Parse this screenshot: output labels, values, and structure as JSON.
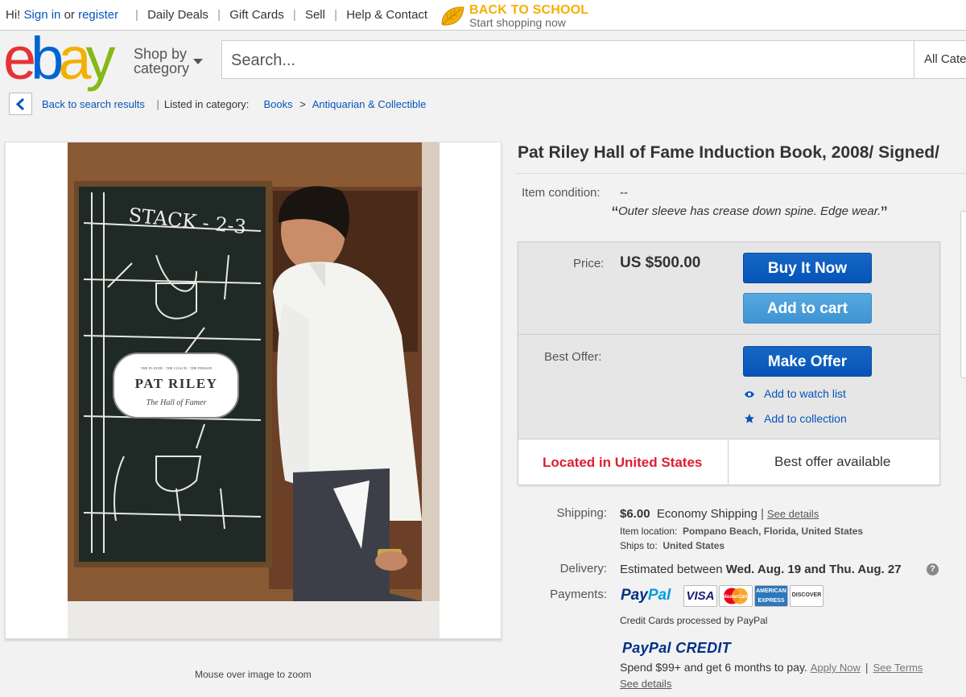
{
  "topbar": {
    "greeting": "Hi!",
    "sign_in": "Sign in",
    "or": "or",
    "register": "register",
    "nav": [
      "Daily Deals",
      "Gift Cards",
      "Sell",
      "Help & Contact"
    ],
    "promo_title": "BACK TO SCHOOL",
    "promo_sub": "Start shopping now"
  },
  "header": {
    "logo_letters": [
      "e",
      "b",
      "a",
      "y"
    ],
    "logo_colors": [
      "#e53238",
      "#0064d2",
      "#f5af02",
      "#86b817"
    ],
    "shop_by_line1": "Shop by",
    "shop_by_line2": "category",
    "search_placeholder": "Search...",
    "category_select": "All Cate"
  },
  "breadcrumb": {
    "back": "Back to search results",
    "listed": "Listed in category:",
    "cat1": "Books",
    "arrow": ">",
    "cat2": "Antiquarian & Collectible"
  },
  "image": {
    "cover_title": "PAT RILEY",
    "cover_tag": "THE PLAYER · THE COACH · THE PERSON",
    "cover_sub": "The Hall of Famer",
    "chalk_text": "STACK - 2-3",
    "zoom_hint": "Mouse over image to zoom"
  },
  "item": {
    "title": "Pat Riley Hall of Fame Induction Book, 2008/ Signed/",
    "condition_label": "Item condition:",
    "condition_value": "--",
    "condition_note": "Outer sleeve has crease down spine. Edge wear.",
    "open_quote": "“",
    "close_quote": "”"
  },
  "buybox": {
    "price_label": "Price:",
    "price": "US $500.00",
    "buy_now": "Buy It Now",
    "add_to_cart": "Add to cart",
    "best_offer_label": "Best Offer:",
    "make_offer": "Make Offer",
    "watch": "Add to watch list",
    "collection": "Add to collection",
    "located": "Located in United States",
    "best_offer_available": "Best offer available"
  },
  "shipping": {
    "label": "Shipping:",
    "cost": "$6.00",
    "method": "Economy Shipping",
    "sep": "|",
    "see_details": "See details",
    "location_label": "Item location:",
    "location": "Pompano Beach, Florida, United States",
    "ships_to_label": "Ships to:",
    "ships_to": "United States"
  },
  "delivery": {
    "label": "Delivery:",
    "prefix": "Estimated between",
    "range": "Wed. Aug. 19 and Thu. Aug. 27",
    "help": "?"
  },
  "payments": {
    "label": "Payments:",
    "paypal_a": "Pay",
    "paypal_b": "Pal",
    "cards": [
      "VISA",
      "MasterCard",
      "AMERICAN EXPRESS",
      "DISCOVER"
    ],
    "cc_note": "Credit Cards processed by PayPal",
    "credit_logo_a": "PayPal",
    "credit_logo_b": "CREDIT",
    "credit_offer": "Spend $99+ and get 6 months to pay.",
    "apply_now": "Apply Now",
    "sep": "|",
    "see_terms": "See Terms",
    "see_details": "See details"
  }
}
